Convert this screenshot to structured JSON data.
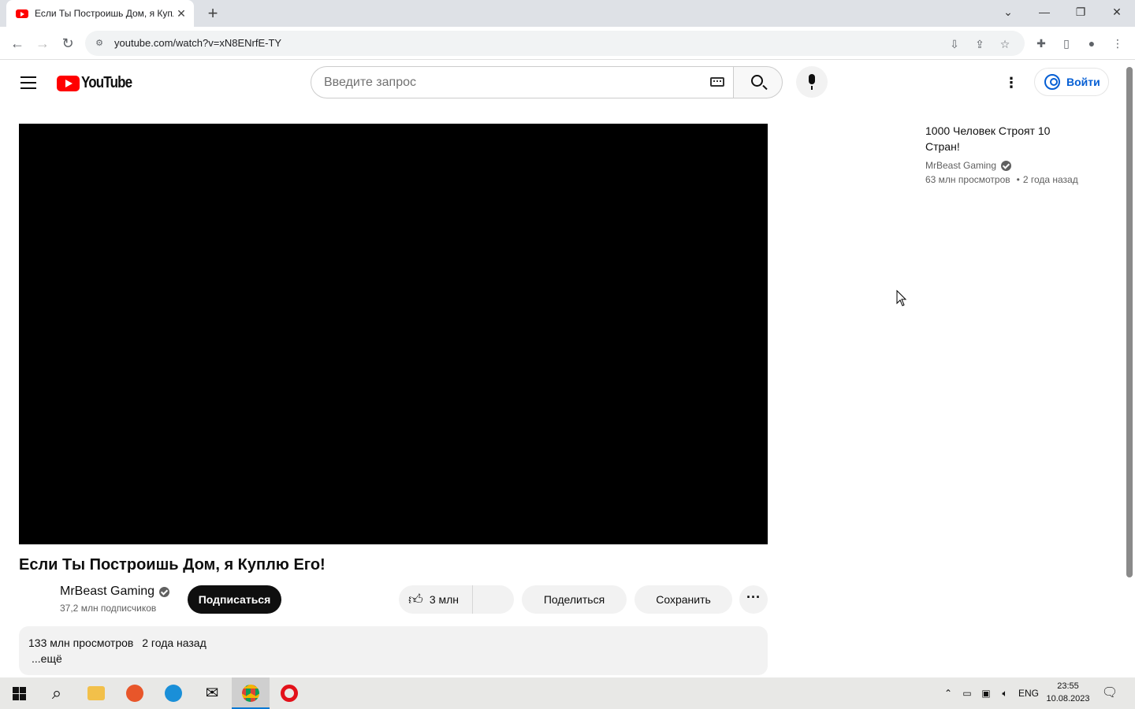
{
  "browser": {
    "tab_title": "Если Ты Построишь Дом, я Куплю Его! - YouTube",
    "new_tab_label": "+",
    "url": "youtube.com/watch?v=xN8ENrfE-TY"
  },
  "youtube": {
    "logo_text": "YouTube",
    "search_placeholder": "Введите запрос",
    "signin_label": "Войти"
  },
  "video": {
    "title": "Если Ты Построишь Дом, я Куплю Его!",
    "channel": "MrBeast Gaming",
    "subscribers": "37,2 млн подписчиков",
    "subscribe_label": "Подписаться",
    "likes": "3 млн",
    "share_label": "Поделиться",
    "save_label": "Сохранить",
    "views": "133 млн просмотров",
    "published": "2 года назад",
    "more_label": "...ещё"
  },
  "recommendation": {
    "title": "1000 Человек Строят 10 Стран!",
    "channel": "MrBeast Gaming",
    "views": "63 млн просмотров",
    "published": "2 года назад"
  },
  "taskbar": {
    "language": "ENG",
    "time": "23:55",
    "date": "10.08.2023"
  }
}
